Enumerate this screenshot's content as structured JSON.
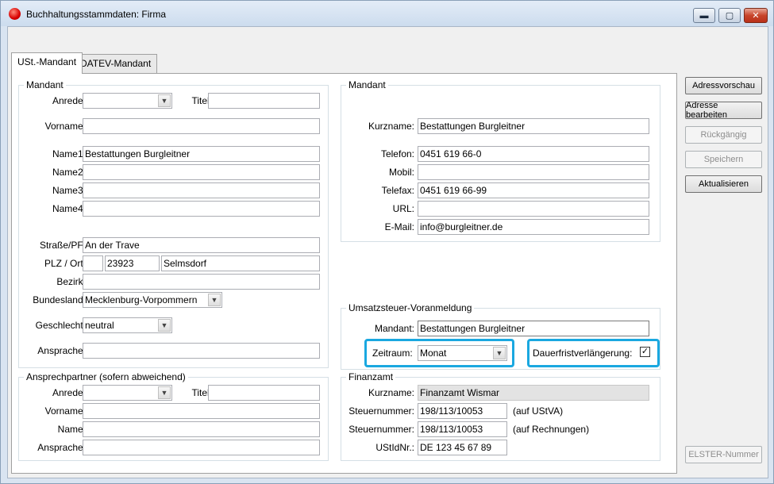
{
  "window": {
    "title": "Buchhaltungsstammdaten: Firma",
    "minimize_icon": "minimize-icon",
    "maximize_icon": "maximize-icon",
    "close_icon": "close-icon"
  },
  "tabs": [
    {
      "label": "USt.-Mandant"
    },
    {
      "label": "DATEV-Mandant"
    }
  ],
  "mandant_left": {
    "title": "Mandant",
    "anrede_label": "Anrede:",
    "anrede_value": "",
    "titel_label": "Titel:",
    "titel_value": "",
    "vorname_label": "Vorname:",
    "vorname_value": "",
    "name1_label": "Name1:",
    "name1_value": "Bestattungen Burgleitner",
    "name2_label": "Name2:",
    "name2_value": "",
    "name3_label": "Name3:",
    "name3_value": "",
    "name4_label": "Name4:",
    "name4_value": "",
    "strasse_label": "Straße/PF:",
    "strasse_value": "An der Trave",
    "plz_label": "PLZ / Ort:",
    "land_value": "",
    "plz_value": "23923",
    "ort_value": "Selmsdorf",
    "bezirk_label": "Bezirk:",
    "bezirk_value": "",
    "bundesland_label": "Bundesland:",
    "bundesland_value": "Mecklenburg-Vorpommern",
    "geschlecht_label": "Geschlecht:",
    "geschlecht_value": "neutral",
    "ansprache_label": "Ansprache:",
    "ansprache_value": ""
  },
  "ansprechpartner": {
    "title": "Ansprechpartner (sofern abweichend)",
    "anrede_label": "Anrede:",
    "titel_label": "Titel:",
    "vorname_label": "Vorname:",
    "name_label": "Name:",
    "ansprache_label": "Ansprache:"
  },
  "mandant_right": {
    "title": "Mandant",
    "kurzname_label": "Kurzname:",
    "kurzname_value": "Bestattungen Burgleitner",
    "telefon_label": "Telefon:",
    "telefon_value": "0451  619 66-0",
    "mobil_label": "Mobil:",
    "mobil_value": "",
    "telefax_label": "Telefax:",
    "telefax_value": "0451  619 66-99",
    "url_label": "URL:",
    "url_value": "",
    "email_label": "E-Mail:",
    "email_value": "info@burgleitner.de"
  },
  "ustva": {
    "title": "Umsatzsteuer-Voranmeldung",
    "mandant_label": "Mandant:",
    "mandant_value": "Bestattungen Burgleitner",
    "zeitraum_label": "Zeitraum:",
    "zeitraum_value": "Monat",
    "dauerfrist_label": "Dauerfristverlängerung:",
    "dauerfrist_checked": "✓"
  },
  "finanzamt": {
    "title": "Finanzamt",
    "kurzname_label": "Kurzname:",
    "kurzname_value": "Finanzamt Wismar",
    "steuernummer_label": "Steuernummer:",
    "steuernummer1_value": "198/113/10053",
    "steuernummer1_note": "(auf UStVA)",
    "steuernummer2_value": "198/113/10053",
    "steuernummer2_note": "(auf Rechnungen)",
    "ustid_label": "UStIdNr.:",
    "ustid_value": "DE 123 45 67 89"
  },
  "buttons": {
    "adressvorschau": "Adressvorschau",
    "adresse_bearbeiten": "Adresse bearbeiten",
    "rueckgaengig": "Rückgängig",
    "speichern": "Speichern",
    "aktualisieren": "Aktualisieren",
    "elster_nummer": "ELSTER-Nummer"
  },
  "colors": {
    "highlight": "#1aa8e0",
    "window_frame": "#d9e4f1"
  }
}
